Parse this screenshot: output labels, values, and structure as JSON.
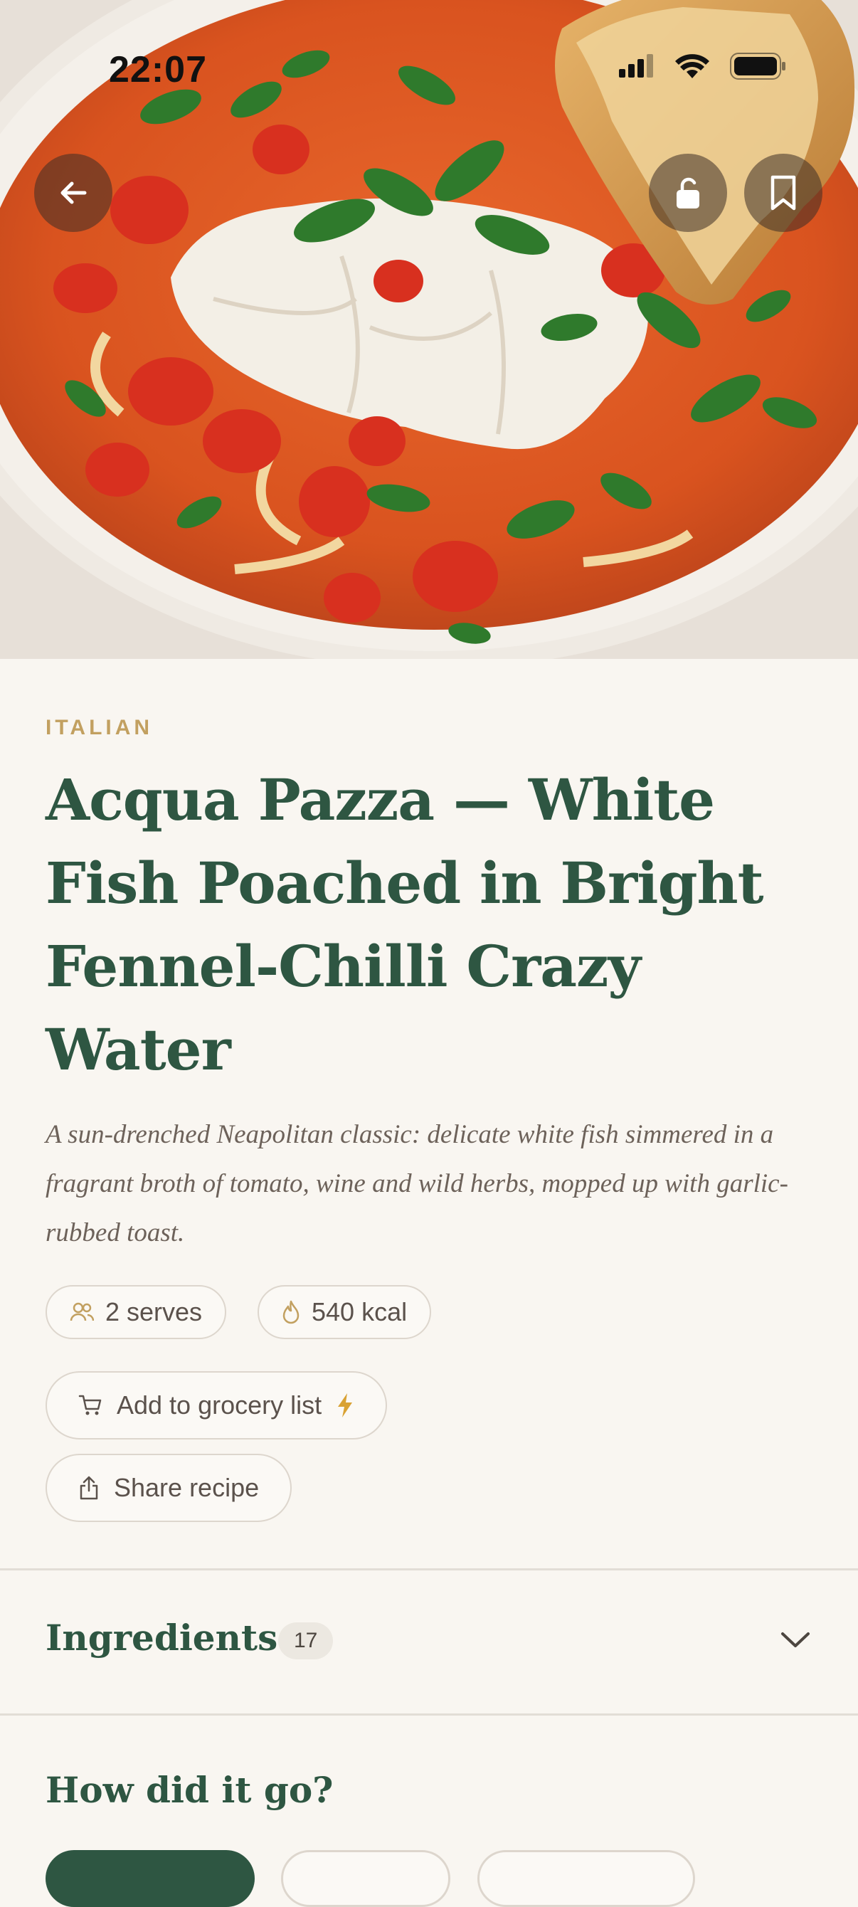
{
  "status_bar": {
    "time": "22:07"
  },
  "hero": {
    "image": "acqua-pazza-photo"
  },
  "top_bar": {
    "back_icon": "arrow-left-icon",
    "lock_icon": "unlock-icon",
    "bookmark_icon": "bookmark-icon"
  },
  "recipe": {
    "category": "ITALIAN",
    "title": "Acqua Pazza — White Fish Poached in Bright Fennel-Chilli Crazy Water",
    "subtitle": "A sun-drenched Neapolitan classic: delicate white fish simmered in a fragrant broth of tomato, wine and wild herbs, mopped up with garlic-rubbed toast.",
    "serves": "2 serves",
    "calories": "540 kcal"
  },
  "actions": {
    "grocery_label": "Add to grocery list",
    "share_label": "Share recipe"
  },
  "ingredients": {
    "label": "Ingredients",
    "count": "17"
  },
  "feedback": {
    "title": "How did it go?"
  },
  "colors": {
    "accent_green": "#2e5642",
    "category_gold": "#c2a060",
    "background": "#f9f6f1"
  }
}
